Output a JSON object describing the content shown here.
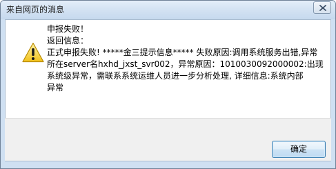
{
  "dialog": {
    "title": "来自网页的消息",
    "icon": "warning-icon",
    "message_lines": [
      "申报失败！",
      "返回信息：",
      "正式申报失败! *****金三提示信息***** 失败原因:调用系统服务出错,异常",
      "所在server名hxhd_jxst_svr002，异常原因：1010030092000002:出现",
      "系统级异常，需联系系统运维人员进一步分析处理, 详细信息:系统内部",
      "异常"
    ],
    "ok_label": "确定"
  }
}
